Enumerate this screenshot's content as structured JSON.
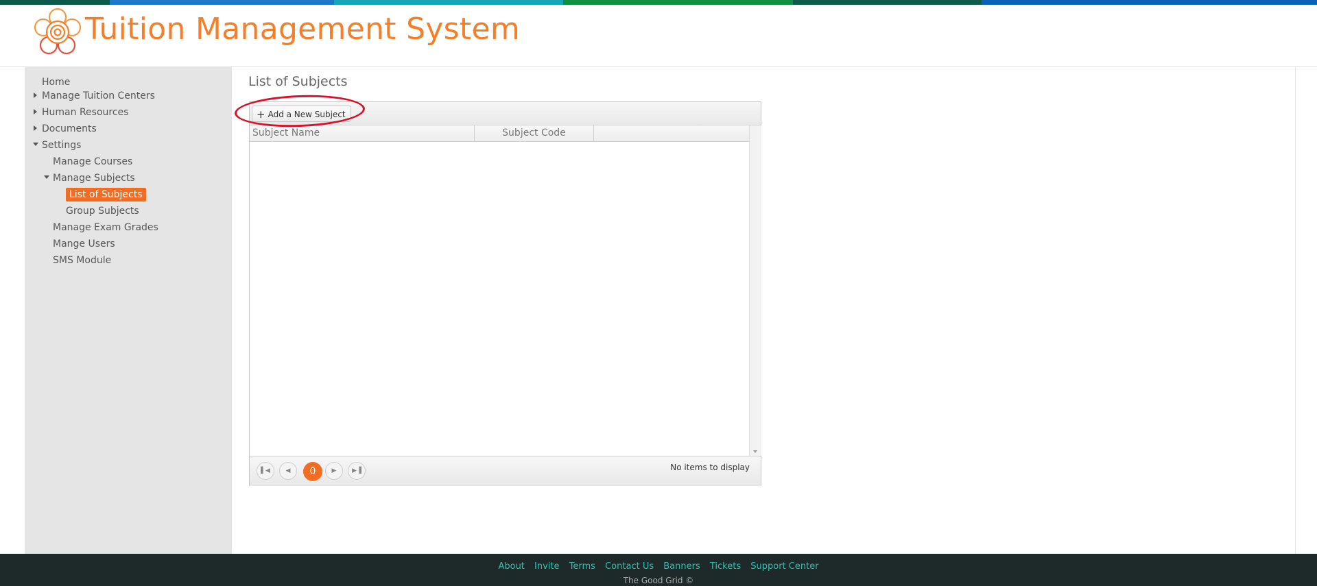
{
  "colors": {
    "accent": "#f26c22",
    "title": "#f37f2a",
    "annotation": "#d9102a",
    "footer_bg": "#1e2a2a",
    "footer_link": "#2fc0b0",
    "topbar": [
      "#0b5a4a",
      "#1e78c8",
      "#15a7b5",
      "#0f8f42",
      "#0d5c4c",
      "#0a63b8"
    ]
  },
  "header": {
    "title": "Tuition Management System",
    "logo_icon": "flower-logo-icon"
  },
  "sidebar": {
    "home": "Home",
    "manage_tuition_centers": "Manage Tuition Centers",
    "human_resources": "Human Resources",
    "documents": "Documents",
    "settings": "Settings",
    "manage_courses": "Manage Courses",
    "manage_subjects": "Manage Subjects",
    "list_of_subjects": "List of Subjects",
    "group_subjects": "Group Subjects",
    "manage_exam_grades": "Manage Exam Grades",
    "mange_users": "Mange Users",
    "sms_module": "SMS Module"
  },
  "main": {
    "page_title": "List of Subjects",
    "toolbar": {
      "add_button_label": "Add a New Subject",
      "add_icon": "plus-icon"
    },
    "columns": [
      "Subject Name",
      "Subject Code"
    ],
    "pager": {
      "current_page": "0",
      "info": "No items to display"
    }
  },
  "footer": {
    "links": [
      "About",
      "Invite",
      "Terms",
      "Contact Us",
      "Banners",
      "Tickets",
      "Support Center"
    ],
    "copyright": "The Good Grid ©"
  }
}
